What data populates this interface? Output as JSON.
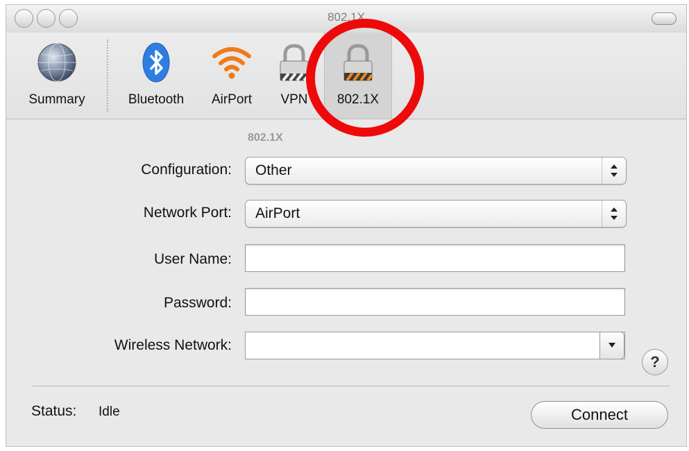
{
  "window": {
    "title": "802.1X"
  },
  "toolbar": {
    "items": [
      {
        "label": "Summary",
        "icon": "globe-icon"
      },
      {
        "label": "Bluetooth",
        "icon": "bluetooth-icon"
      },
      {
        "label": "AirPort",
        "icon": "wifi-icon"
      },
      {
        "label": "VPN",
        "icon": "lock-icon"
      },
      {
        "label": "802.1X",
        "icon": "lock-icon"
      }
    ],
    "selected": "802.1X"
  },
  "form": {
    "section_title": "802.1X",
    "configuration_label": "Configuration:",
    "configuration_value": "Other",
    "network_port_label": "Network Port:",
    "network_port_value": "AirPort",
    "user_name_label": "User Name:",
    "user_name_value": "",
    "password_label": "Password:",
    "password_value": "",
    "wireless_network_label": "Wireless Network:",
    "wireless_network_value": ""
  },
  "help_button": "?",
  "status": {
    "label": "Status:",
    "value": "Idle"
  },
  "connect_button": "Connect",
  "colors": {
    "annotation": "#ee0a0a",
    "wifi": "#f07a1a",
    "bluetooth": "#2f7de1"
  }
}
